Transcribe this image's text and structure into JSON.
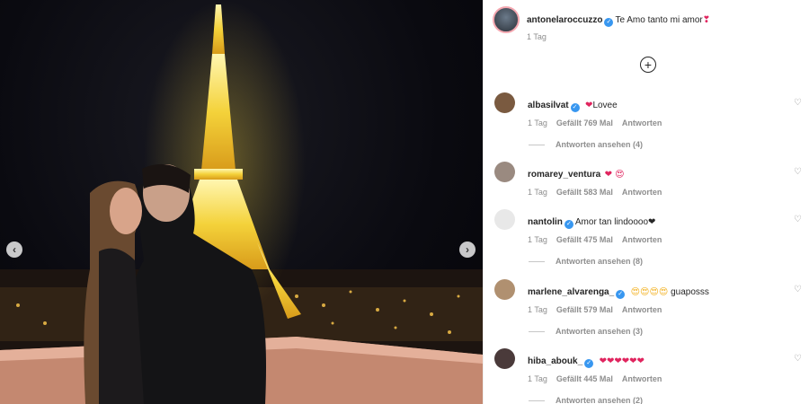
{
  "post": {
    "username": "antonelaroccuzzo",
    "caption": "Te Amo tanto mi amor",
    "caption_emoji": "❣",
    "time": "1 Tag",
    "load_more_icon": "plus-circle-icon"
  },
  "comments": [
    {
      "username": "albasilvat",
      "verified": true,
      "emoji": "❤",
      "text": "Lovee",
      "time": "1 Tag",
      "likes": "Gefällt 769 Mal",
      "reply": "Antworten",
      "replies": "Antworten ansehen (4)",
      "avatar_color": "#7a5a40"
    },
    {
      "username": "romarey_ventura",
      "verified": false,
      "emoji": "❤ 😍",
      "text": "",
      "time": "1 Tag",
      "likes": "Gefällt 583 Mal",
      "reply": "Antworten",
      "replies": "",
      "avatar_color": "#9a8a80"
    },
    {
      "username": "nantolin",
      "verified": true,
      "emoji": "",
      "text": "Amor tan lindoooo❤",
      "time": "1 Tag",
      "likes": "Gefällt 475 Mal",
      "reply": "Antworten",
      "replies": "Antworten ansehen (8)",
      "avatar_color": "#e8e8e8"
    },
    {
      "username": "marlene_alvarenga_",
      "verified": true,
      "emoji": "😍😍😍😍",
      "text": " guaposss",
      "time": "1 Tag",
      "likes": "Gefällt 579 Mal",
      "reply": "Antworten",
      "replies": "Antworten ansehen (3)",
      "avatar_color": "#b09070"
    },
    {
      "username": "hiba_abouk_",
      "verified": true,
      "emoji": "❤❤❤❤❤❤",
      "text": "",
      "time": "1 Tag",
      "likes": "Gefällt 445 Mal",
      "reply": "Antworten",
      "replies": "Antworten ansehen (2)",
      "avatar_color": "#4a3a3a"
    }
  ],
  "icons": {
    "prev": "chevron-left-icon",
    "next": "chevron-right-icon",
    "like": "heart-outline-icon",
    "verified": "verified-badge-icon"
  },
  "colors": {
    "accent": "#3897f0",
    "heart": "#e0245e",
    "meta": "#8e8e8e"
  }
}
